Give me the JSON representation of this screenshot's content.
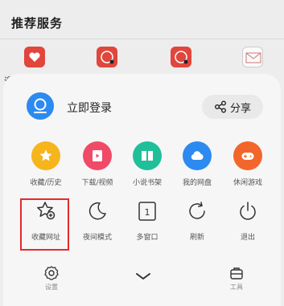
{
  "background": {
    "section_title": "推荐服务",
    "partial_text": "迎"
  },
  "account": {
    "login_label": "立即登录",
    "share_label": "分享"
  },
  "colors": {
    "favorites": "#f7b51c",
    "downloads": "#f04a67",
    "novels": "#1fbf9a",
    "cloud": "#2c8af0",
    "games": "#f2662b",
    "highlight": "#e52a2a"
  },
  "menu_row1": [
    {
      "label": "收藏/历史",
      "icon": "star-icon"
    },
    {
      "label": "下载/视频",
      "icon": "download-video-icon"
    },
    {
      "label": "小说书架",
      "icon": "book-icon"
    },
    {
      "label": "我的网盘",
      "icon": "cloud-icon"
    },
    {
      "label": "休闲游戏",
      "icon": "gamepad-icon"
    }
  ],
  "menu_row2": [
    {
      "label": "收藏网址",
      "icon": "star-plus-icon"
    },
    {
      "label": "夜间模式",
      "icon": "moon-icon"
    },
    {
      "label": "多窗口",
      "icon": "window-count-icon",
      "count": "1"
    },
    {
      "label": "刷新",
      "icon": "refresh-icon"
    },
    {
      "label": "退出",
      "icon": "power-icon"
    }
  ],
  "bottom_bar": {
    "settings_label": "设置",
    "tools_label": "工具"
  }
}
